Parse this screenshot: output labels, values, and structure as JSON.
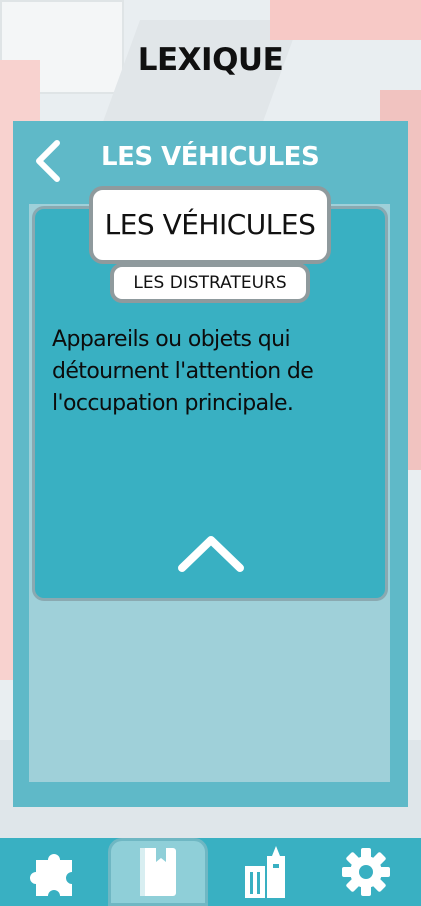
{
  "header": {
    "title": "LEXIQUE"
  },
  "panel": {
    "title": "LES VÉHICULES",
    "back_icon": "chevron-left-icon"
  },
  "card": {
    "tab_main": "LES VÉHICULES",
    "tab_sub": "LES DISTRATEURS",
    "definition": "Appareils ou objets qui détournent l'attention de l'occupation principale.",
    "collapse_icon": "chevron-up-icon"
  },
  "bottom_nav": {
    "items": [
      {
        "icon": "puzzle-icon",
        "active": false
      },
      {
        "icon": "book-icon",
        "active": true
      },
      {
        "icon": "building-icon",
        "active": false
      },
      {
        "icon": "gear-icon",
        "active": false
      }
    ]
  },
  "colors": {
    "panel": "#5fb9c8",
    "card": "#39b0c2",
    "nav_bar": "#39b0c2",
    "active_tab": "#8fcfd8"
  }
}
